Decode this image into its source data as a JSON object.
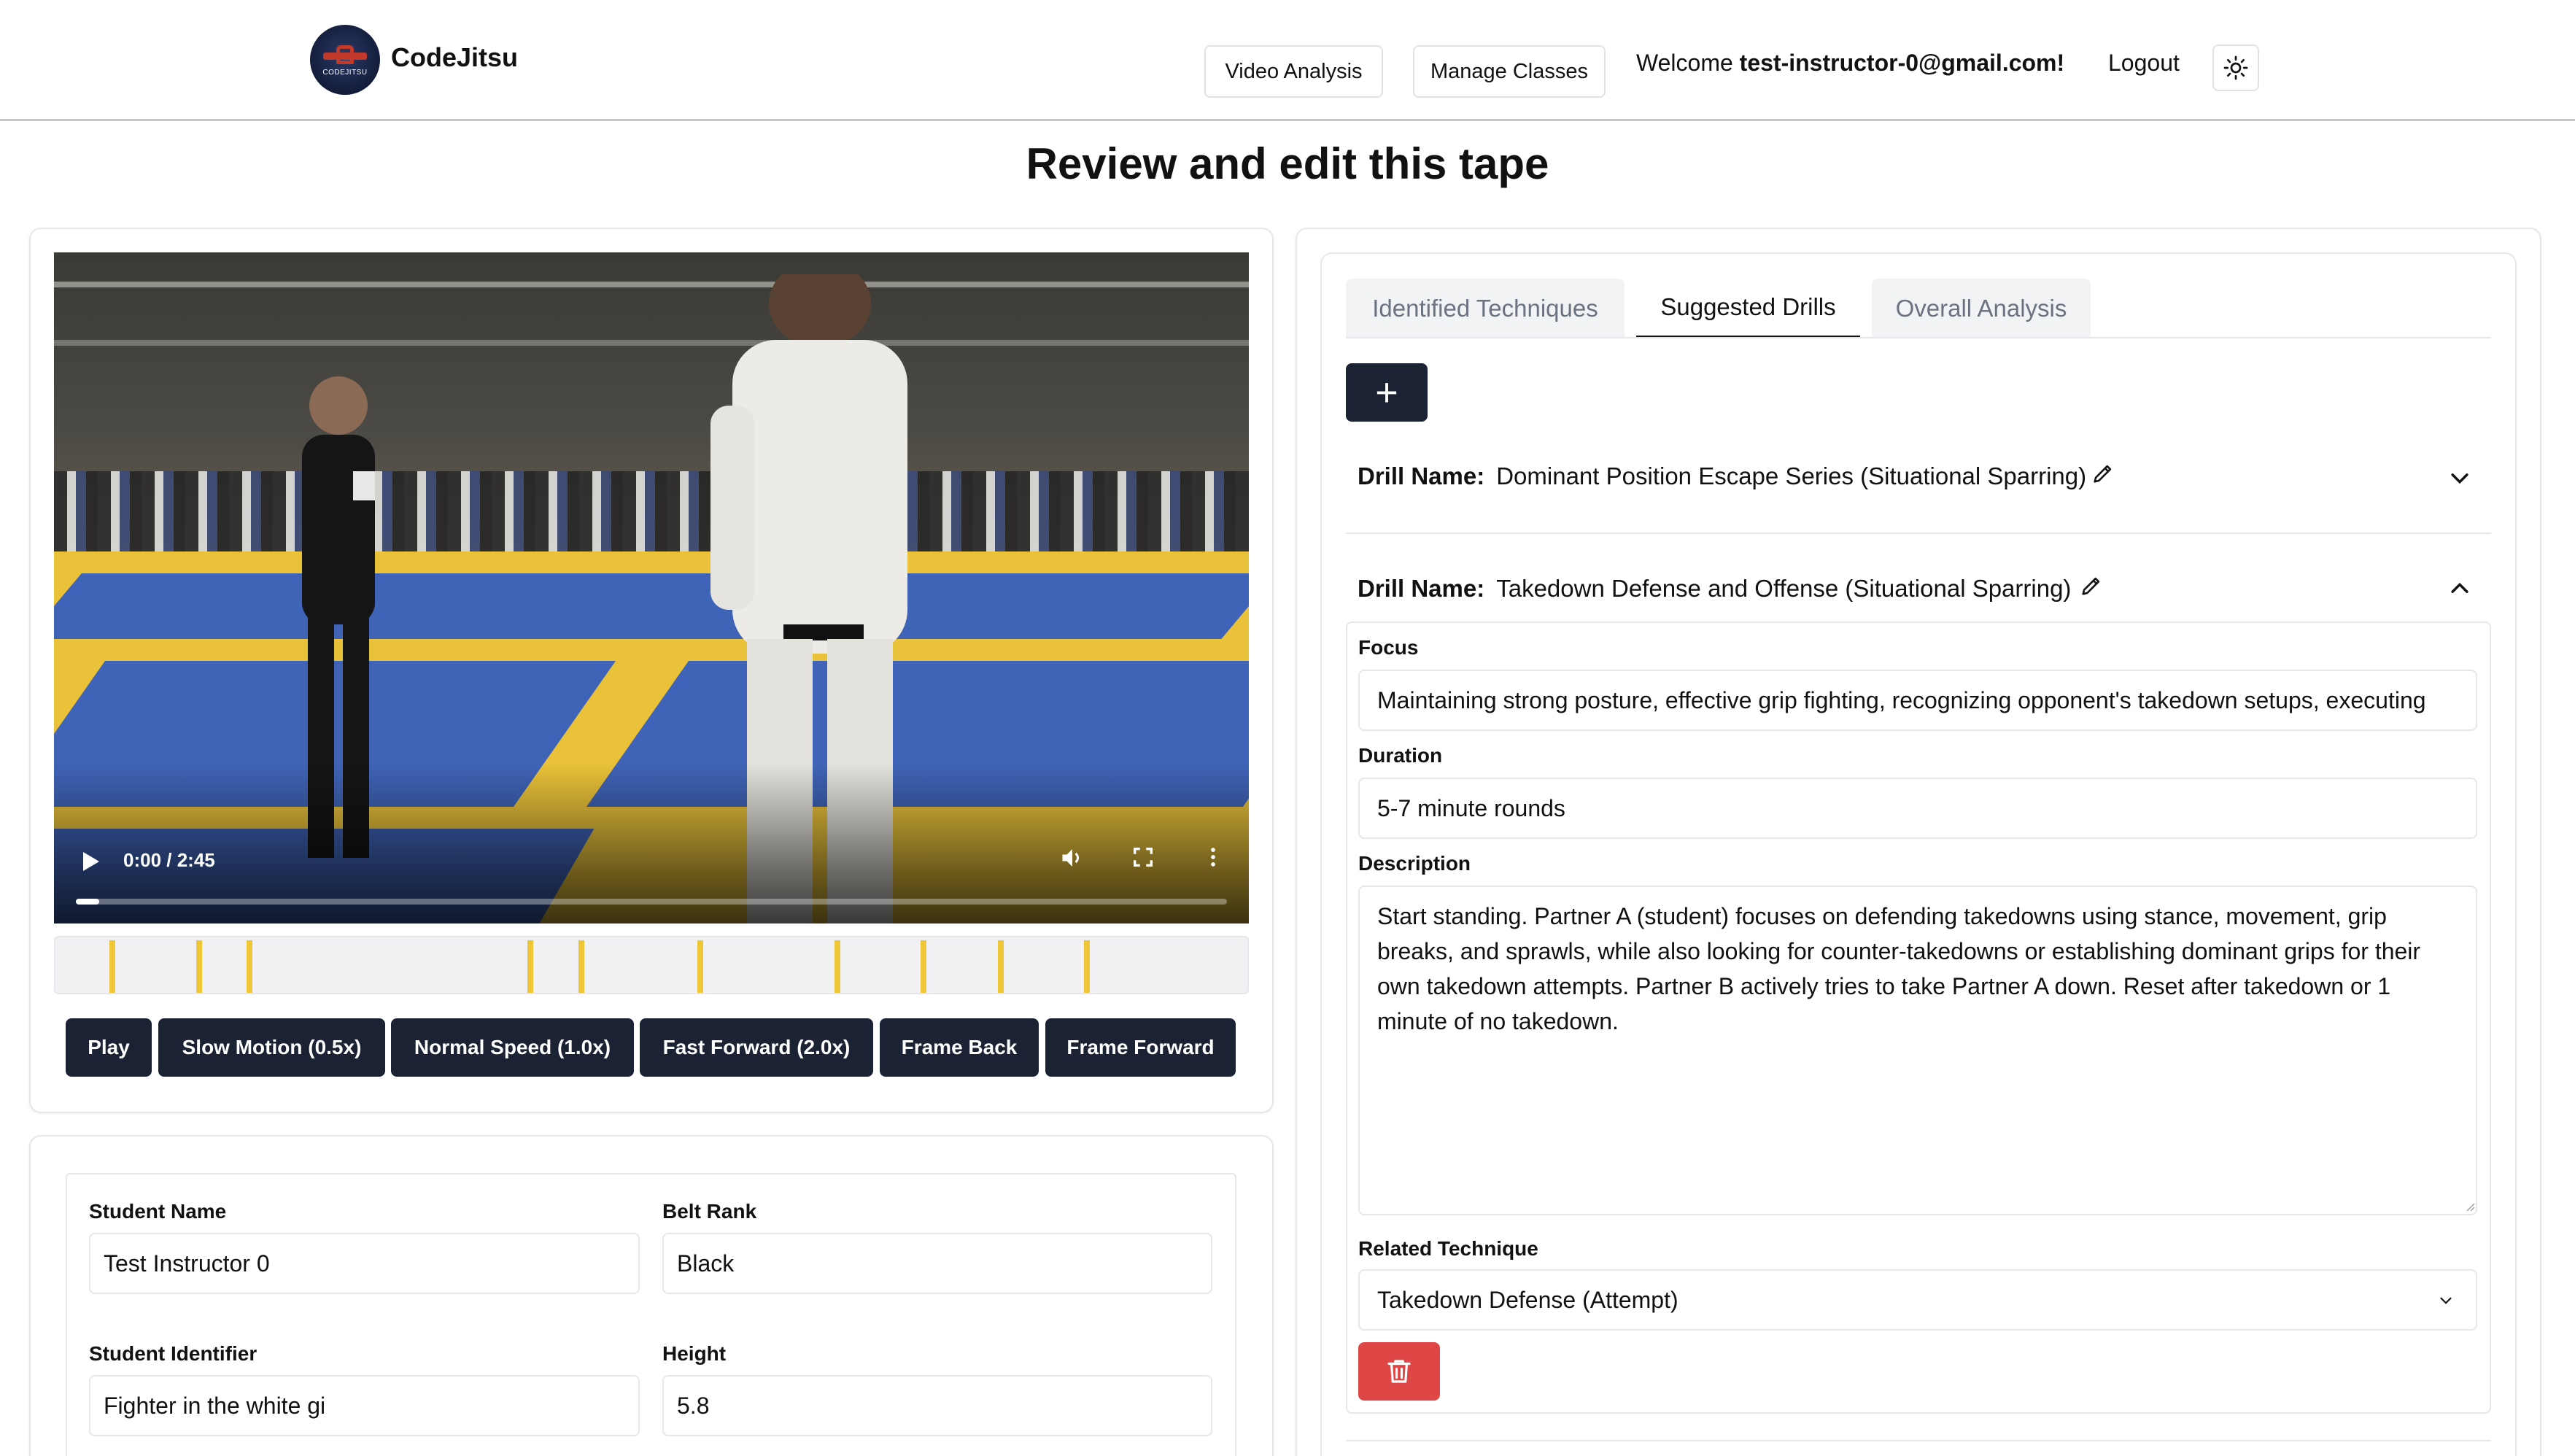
{
  "header": {
    "logo_text": "CODEJITSU",
    "brand": "CodeJitsu",
    "nav": [
      "Video Analysis",
      "Manage Classes"
    ],
    "welcome_prefix": "Welcome ",
    "welcome_user": "test-instructor-0@gmail.com!",
    "logout": "Logout"
  },
  "page_title": "Review and edit this tape",
  "video": {
    "time": "0:00 / 2:45",
    "progress_fraction": 0.02,
    "markers_fraction": [
      0.045,
      0.118,
      0.16,
      0.395,
      0.438,
      0.537,
      0.652,
      0.724,
      0.789,
      0.861
    ]
  },
  "controls": [
    "Play",
    "Slow Motion (0.5x)",
    "Normal Speed (1.0x)",
    "Fast Forward (2.0x)",
    "Frame Back",
    "Frame Forward"
  ],
  "student": {
    "name_label": "Student Name",
    "name_value": "Test Instructor 0",
    "belt_label": "Belt Rank",
    "belt_value": "Black",
    "identifier_label": "Student Identifier",
    "identifier_value": "Fighter in the white gi",
    "height_label": "Height",
    "height_value": "5.8"
  },
  "tabs": [
    "Identified Techniques",
    "Suggested Drills",
    "Overall Analysis"
  ],
  "active_tab": "Suggested Drills",
  "add_button": "+",
  "drills": [
    {
      "label": "Drill Name:",
      "name": "Dominant Position Escape Series (Situational Sparring)",
      "expanded": false
    },
    {
      "label": "Drill Name:",
      "name": "Takedown Defense and Offense (Situational Sparring)",
      "expanded": true,
      "focus_label": "Focus",
      "focus": "Maintaining strong posture, effective grip fighting, recognizing opponent's takedown setups, executing",
      "duration_label": "Duration",
      "duration": "5-7 minute rounds",
      "description_label": "Description",
      "description": "Start standing. Partner A (student) focuses on defending takedowns using stance, movement, grip breaks, and sprawls, while also looking for counter-takedowns or establishing dominant grips for their own takedown attempts. Partner B actively tries to take Partner A down. Reset after takedown or 1 minute of no takedown.",
      "technique_label": "Related Technique",
      "technique": "Takedown Defense (Attempt)"
    }
  ],
  "colors": {
    "dark_button": "#1a2233",
    "delete_button": "#df4747",
    "marker": "#efc736"
  }
}
